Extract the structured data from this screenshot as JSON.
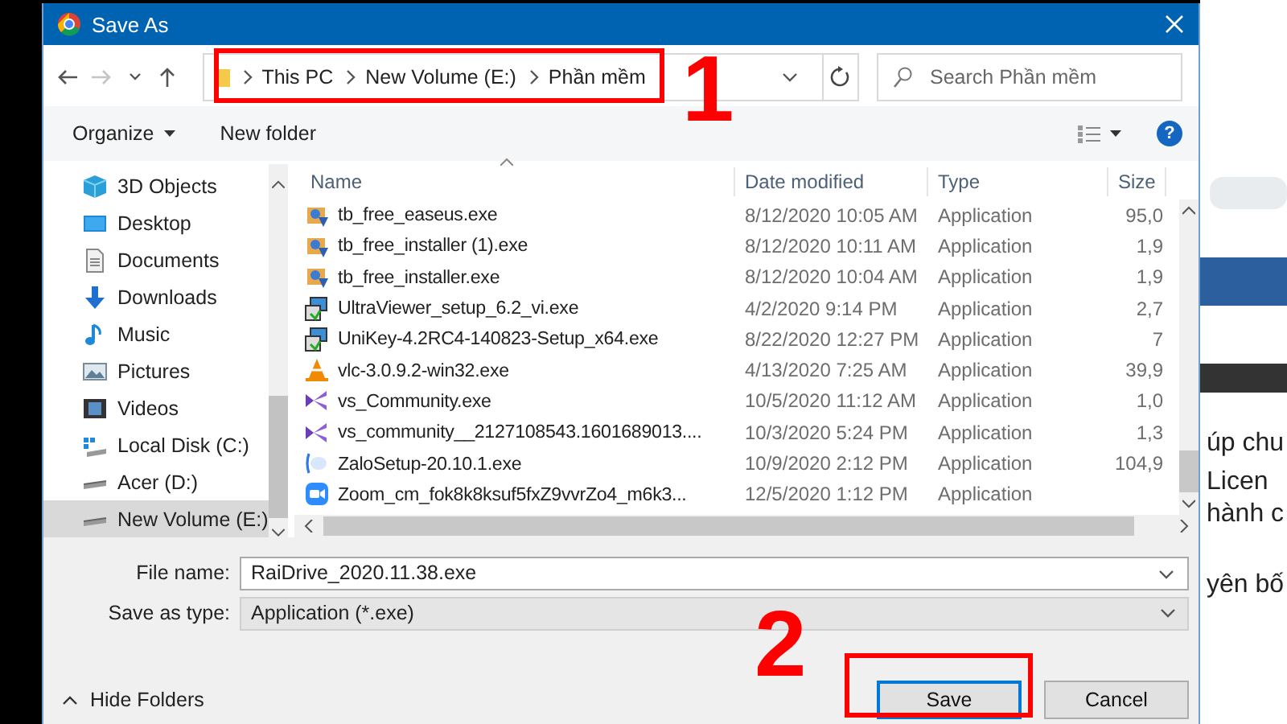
{
  "window": {
    "title": "Save As"
  },
  "nav_buttons": [
    {
      "kind": "back",
      "disabled": false
    },
    {
      "kind": "forward",
      "disabled": true
    },
    {
      "kind": "recent",
      "disabled": false
    },
    {
      "kind": "up",
      "disabled": false
    }
  ],
  "breadcrumb": [
    "This PC",
    "New Volume (E:)",
    "Phần mềm"
  ],
  "search": {
    "placeholder": "Search Phần mềm"
  },
  "toolbar": {
    "organize": "Organize",
    "new_folder": "New folder",
    "help": "?"
  },
  "sidebar": {
    "items": [
      {
        "label": "3D Objects",
        "kind": "objects",
        "selected": false
      },
      {
        "label": "Desktop",
        "kind": "desktop",
        "selected": false
      },
      {
        "label": "Documents",
        "kind": "documents",
        "selected": false
      },
      {
        "label": "Downloads",
        "kind": "downloads",
        "selected": false
      },
      {
        "label": "Music",
        "kind": "music",
        "selected": false
      },
      {
        "label": "Pictures",
        "kind": "pictures",
        "selected": false
      },
      {
        "label": "Videos",
        "kind": "videos",
        "selected": false
      },
      {
        "label": "Local Disk (C:)",
        "kind": "system-disk",
        "selected": false
      },
      {
        "label": "Acer (D:)",
        "kind": "disk",
        "selected": false
      },
      {
        "label": "New Volume (E:)",
        "kind": "disk",
        "selected": true
      }
    ]
  },
  "table": {
    "columns": [
      "Name",
      "Date modified",
      "Type",
      "Size"
    ],
    "rows": [
      {
        "kind": "installer",
        "name": "tb_free_easeus.exe",
        "date": "8/12/2020 10:05 AM",
        "type": "Application",
        "size": "95,0"
      },
      {
        "kind": "installer",
        "name": "tb_free_installer (1).exe",
        "date": "8/12/2020 10:11 AM",
        "type": "Application",
        "size": "1,9"
      },
      {
        "kind": "installer",
        "name": "tb_free_installer.exe",
        "date": "8/12/2020 10:04 AM",
        "type": "Application",
        "size": "1,9"
      },
      {
        "kind": "setup",
        "name": "UltraViewer_setup_6.2_vi.exe",
        "date": "4/2/2020 9:14 PM",
        "type": "Application",
        "size": "2,7"
      },
      {
        "kind": "setup",
        "name": "UniKey-4.2RC4-140823-Setup_x64.exe",
        "date": "8/22/2020 12:27 PM",
        "type": "Application",
        "size": "7"
      },
      {
        "kind": "cone",
        "name": "vlc-3.0.9.2-win32.exe",
        "date": "4/13/2020 7:25 AM",
        "type": "Application",
        "size": "39,9"
      },
      {
        "kind": "studio",
        "name": "vs_Community.exe",
        "date": "10/5/2020 11:12 AM",
        "type": "Application",
        "size": "1,0"
      },
      {
        "kind": "studio",
        "name": "vs_community__2127108543.1601689013....",
        "date": "10/3/2020 5:24 PM",
        "type": "Application",
        "size": "1,3"
      },
      {
        "kind": "chat",
        "name": "ZaloSetup-20.10.1.exe",
        "date": "10/9/2020 2:12 PM",
        "type": "Application",
        "size": "104,9"
      },
      {
        "kind": "camera",
        "name": "Zoom_cm_fok8k8ksuf5fxZ9vvrZo4_m6k3...",
        "date": "12/5/2020 1:12 PM",
        "type": "Application"
      }
    ]
  },
  "form": {
    "file_name": {
      "label": "File name:",
      "value": "RaiDrive_2020.11.38.exe"
    },
    "save_as_type": {
      "label": "Save as type:",
      "value": "Application (*.exe)"
    }
  },
  "hide_folders": "Hide Folders",
  "buttons": [
    {
      "label": "Save",
      "kind": "primary"
    },
    {
      "label": "Cancel",
      "kind": "normal"
    }
  ],
  "background_page": {
    "texts": [
      "úp chu",
      "Licen",
      "hành c",
      "yên bố"
    ]
  },
  "annotations": [
    {
      "label": "1"
    },
    {
      "label": "2"
    }
  ]
}
